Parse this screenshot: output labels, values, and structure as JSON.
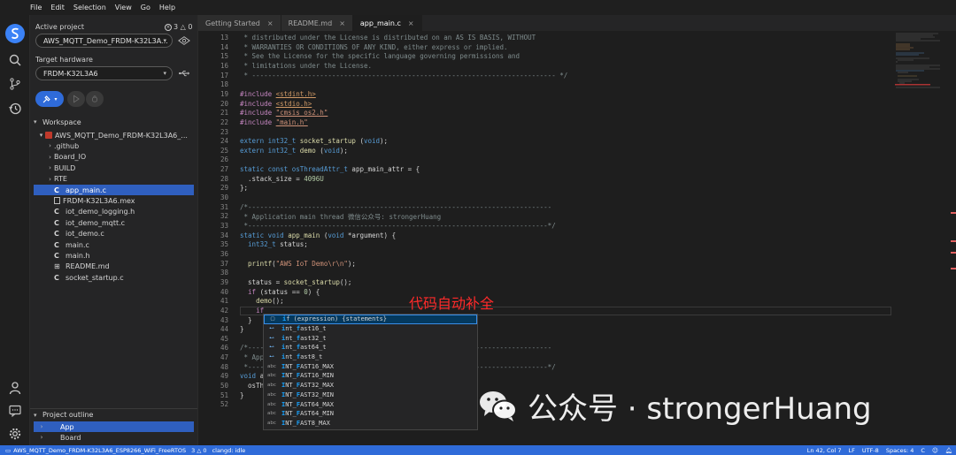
{
  "menu": [
    "File",
    "Edit",
    "Selection",
    "View",
    "Go",
    "Help"
  ],
  "sidebar": {
    "active_project_label": "Active project",
    "status_counts": "3 △ 0",
    "project_select": "AWS_MQTT_Demo_FRDM-K32L3A...",
    "target_label": "Target hardware",
    "target_select": "FRDM-K32L3A6",
    "workspace_header": "Workspace",
    "tree": [
      {
        "label": "AWS_MQTT_Demo_FRDM-K32L3A6_...",
        "indent": 0,
        "arrow": "▾",
        "icon": "project"
      },
      {
        "label": ".github",
        "indent": 1,
        "arrow": "›",
        "icon": "folder"
      },
      {
        "label": "Board_IO",
        "indent": 1,
        "arrow": "›",
        "icon": "folder"
      },
      {
        "label": "BUILD",
        "indent": 1,
        "arrow": "›",
        "icon": "folder"
      },
      {
        "label": "RTE",
        "indent": 1,
        "arrow": "›",
        "icon": "folder"
      },
      {
        "label": "app_main.c",
        "indent": 1,
        "arrow": "",
        "icon": "c",
        "selected": true
      },
      {
        "label": "FRDM-K32L3A6.mex",
        "indent": 1,
        "arrow": "",
        "icon": "file"
      },
      {
        "label": "iot_demo_logging.h",
        "indent": 1,
        "arrow": "",
        "icon": "c"
      },
      {
        "label": "iot_demo_mqtt.c",
        "indent": 1,
        "arrow": "",
        "icon": "c"
      },
      {
        "label": "iot_demo.c",
        "indent": 1,
        "arrow": "",
        "icon": "c"
      },
      {
        "label": "main.c",
        "indent": 1,
        "arrow": "",
        "icon": "c"
      },
      {
        "label": "main.h",
        "indent": 1,
        "arrow": "",
        "icon": "c"
      },
      {
        "label": "README.md",
        "indent": 1,
        "arrow": "",
        "icon": "md"
      },
      {
        "label": "socket_startup.c",
        "indent": 1,
        "arrow": "",
        "icon": "c"
      }
    ],
    "outline_header": "Project outline",
    "outline": [
      {
        "label": "App",
        "selected": true
      },
      {
        "label": "Board",
        "selected": false
      }
    ]
  },
  "tabs": [
    {
      "label": "Getting Started",
      "active": false
    },
    {
      "label": "README.md",
      "active": false
    },
    {
      "label": "app_main.c",
      "active": true
    }
  ],
  "code": [
    {
      "n": "13",
      "html": "<span class='c-com'> * distributed under the License is distributed on an AS IS BASIS, WITHOUT</span>"
    },
    {
      "n": "14",
      "html": "<span class='c-com'> * WARRANTIES OR CONDITIONS OF ANY KIND, either express or implied.</span>"
    },
    {
      "n": "15",
      "html": "<span class='c-com'> * See the License for the specific language governing permissions and</span>"
    },
    {
      "n": "16",
      "html": "<span class='c-com'> * limitations under the License.</span>"
    },
    {
      "n": "17",
      "html": "<span class='c-com'> * ---------------------------------------------------------------------------- */</span>"
    },
    {
      "n": "18",
      "html": ""
    },
    {
      "n": "19",
      "html": "<span class='c-pp'>#include</span> <span class='c-inc'><u>&lt;stdint.h&gt;</u></span>"
    },
    {
      "n": "20",
      "html": "<span class='c-pp'>#include</span> <span class='c-inc'><u>&lt;stdio.h&gt;</u></span>"
    },
    {
      "n": "21",
      "html": "<span class='c-pp'>#include</span> <span class='c-str'><u>\"cmsis_os2.h\"</u></span>"
    },
    {
      "n": "22",
      "html": "<span class='c-pp'>#include</span> <span class='c-str'><u>\"main.h\"</u></span>"
    },
    {
      "n": "23",
      "html": ""
    },
    {
      "n": "24",
      "html": "<span class='c-kw'>extern</span> <span class='c-kw'>int32_t</span> <span class='c-fn'>socket_startup</span> (<span class='c-kw'>void</span>);"
    },
    {
      "n": "25",
      "html": "<span class='c-kw'>extern</span> <span class='c-kw'>int32_t</span> <span class='c-fn'>demo</span> (<span class='c-kw'>void</span>);"
    },
    {
      "n": "26",
      "html": ""
    },
    {
      "n": "27",
      "html": "<span class='c-kw'>static</span> <span class='c-kw'>const</span> <span class='c-kw'>osThreadAttr_t</span> app_main_attr = {"
    },
    {
      "n": "28",
      "html": "  .stack_size = <span class='c-num'>4096U</span>"
    },
    {
      "n": "29",
      "html": "};"
    },
    {
      "n": "30",
      "html": ""
    },
    {
      "n": "31",
      "html": "<span class='c-com'>/*----------------------------------------------------------------------------</span>"
    },
    {
      "n": "32",
      "html": "<span class='c-com'> * Application main thread 微信公众号: strongerHuang</span>"
    },
    {
      "n": "33",
      "html": "<span class='c-com'> *---------------------------------------------------------------------------*/</span>"
    },
    {
      "n": "34",
      "html": "<span class='c-kw'>static</span> <span class='c-kw'>void</span> <span class='c-fn'>app_main</span> (<span class='c-kw'>void</span> *argument) {"
    },
    {
      "n": "35",
      "html": "  <span class='c-kw'>int32_t</span> status;"
    },
    {
      "n": "36",
      "html": ""
    },
    {
      "n": "37",
      "html": "  <span class='c-fn'>printf</span>(<span class='c-str'>\"AWS IoT Demo\\r\\n\"</span>);"
    },
    {
      "n": "38",
      "html": ""
    },
    {
      "n": "39",
      "html": "  status = <span class='c-fn'>socket_startup</span>();"
    },
    {
      "n": "40",
      "html": "  <span class='c-pp'>if</span> (status == <span class='c-num'>0</span>) {"
    },
    {
      "n": "41",
      "html": "    <span class='c-fn'>demo</span>();"
    },
    {
      "n": "42",
      "html": "    <span class='c-pp'>if</span>"
    },
    {
      "n": "43",
      "html": "  }"
    },
    {
      "n": "44",
      "html": "}"
    },
    {
      "n": "45",
      "html": ""
    },
    {
      "n": "46",
      "html": "<span class='c-com'>/*----------------------------------------------------------------------------</span>"
    },
    {
      "n": "47",
      "html": "<span class='c-com'> * App</span>"
    },
    {
      "n": "48",
      "html": "<span class='c-com'> *---------------------------------------------------------------------------*/</span>"
    },
    {
      "n": "49",
      "html": "<span class='c-kw'>void</span> a"
    },
    {
      "n": "50",
      "html": "  osTh"
    },
    {
      "n": "51",
      "html": "}"
    },
    {
      "n": "52",
      "html": ""
    }
  ],
  "annotation": "代码自动补全",
  "suggestions": [
    {
      "kind": "snippet",
      "label": "if (expression) {statements}",
      "match": "i",
      "rest": "f (expression) {statements}",
      "selected": true
    },
    {
      "kind": "macro",
      "label": "int_fast16_t",
      "match": "i",
      "rest": "nt_",
      "match2": "f",
      "rest2": "ast16_t"
    },
    {
      "kind": "macro",
      "label": "int_fast32_t",
      "match": "i",
      "rest": "nt_",
      "match2": "f",
      "rest2": "ast32_t"
    },
    {
      "kind": "macro",
      "label": "int_fast64_t",
      "match": "i",
      "rest": "nt_",
      "match2": "f",
      "rest2": "ast64_t"
    },
    {
      "kind": "macro",
      "label": "int_fast8_t",
      "match": "i",
      "rest": "nt_",
      "match2": "f",
      "rest2": "ast8_t"
    },
    {
      "kind": "abc",
      "label": "INT_FAST16_MAX",
      "match": "I",
      "rest": "NT_",
      "match2": "F",
      "rest2": "AST16_MAX"
    },
    {
      "kind": "abc",
      "label": "INT_FAST16_MIN",
      "match": "I",
      "rest": "NT_",
      "match2": "F",
      "rest2": "AST16_MIN"
    },
    {
      "kind": "abc",
      "label": "INT_FAST32_MAX",
      "match": "I",
      "rest": "NT_",
      "match2": "F",
      "rest2": "AST32_MAX"
    },
    {
      "kind": "abc",
      "label": "INT_FAST32_MIN",
      "match": "I",
      "rest": "NT_",
      "match2": "F",
      "rest2": "AST32_MIN"
    },
    {
      "kind": "abc",
      "label": "INT_FAST64_MAX",
      "match": "I",
      "rest": "NT_",
      "match2": "F",
      "rest2": "AST64_MAX"
    },
    {
      "kind": "abc",
      "label": "INT_FAST64_MIN",
      "match": "I",
      "rest": "NT_",
      "match2": "F",
      "rest2": "AST64_MIN"
    },
    {
      "kind": "abc",
      "label": "INT_FAST8_MAX",
      "match": "I",
      "rest": "NT_",
      "match2": "F",
      "rest2": "AST8_MAX"
    }
  ],
  "watermark": "公众号 · strongerHuang",
  "status": {
    "project": "AWS_MQTT_Demo_FRDM-K32L3A6_ESP8266_WiFi_FreeRTOS",
    "problems": "3 △ 0",
    "clangd": "clangd: idle",
    "position": "Ln 42, Col 7",
    "eol": "LF",
    "encoding": "UTF-8",
    "spaces": "Spaces: 4",
    "lang": "C"
  },
  "colors": {
    "accent": "#2f6bd9",
    "selection": "#2f5fbf",
    "logo": "#3b82f6"
  }
}
